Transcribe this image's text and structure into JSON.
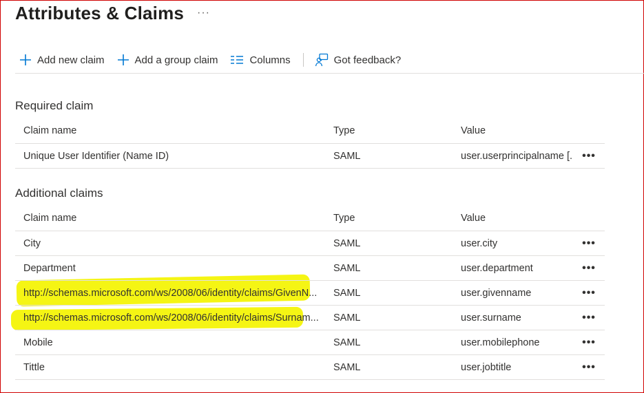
{
  "header": {
    "title": "Attributes & Claims",
    "more": "···"
  },
  "toolbar": {
    "add_new_claim": "Add new claim",
    "add_group_claim": "Add a group claim",
    "columns": "Columns",
    "feedback": "Got feedback?"
  },
  "icons": {
    "add": "plus-icon",
    "columns": "columns-list-icon",
    "feedback": "feedback-person-icon",
    "more": "ellipsis-icon"
  },
  "colors": {
    "accent": "#0078d4",
    "highlight": "#f4f400",
    "frame": "#d00000"
  },
  "required": {
    "title": "Required claim",
    "columns": {
      "name": "Claim name",
      "type": "Type",
      "value": "Value"
    },
    "rows": [
      {
        "name": "Unique User Identifier (Name ID)",
        "type": "SAML",
        "value": "user.userprincipalname [..."
      }
    ]
  },
  "additional": {
    "title": "Additional claims",
    "columns": {
      "name": "Claim name",
      "type": "Type",
      "value": "Value"
    },
    "rows": [
      {
        "name": "City",
        "type": "SAML",
        "value": "user.city"
      },
      {
        "name": "Department",
        "type": "SAML",
        "value": "user.department"
      },
      {
        "name": "http://schemas.microsoft.com/ws/2008/06/identity/claims/GivenN...",
        "type": "SAML",
        "value": "user.givenname"
      },
      {
        "name": "http://schemas.microsoft.com/ws/2008/06/identity/claims/Surnam...",
        "type": "SAML",
        "value": "user.surname"
      },
      {
        "name": "Mobile",
        "type": "SAML",
        "value": "user.mobilephone"
      },
      {
        "name": "Tittle",
        "type": "SAML",
        "value": "user.jobtitle"
      }
    ]
  },
  "row_more": "•••"
}
